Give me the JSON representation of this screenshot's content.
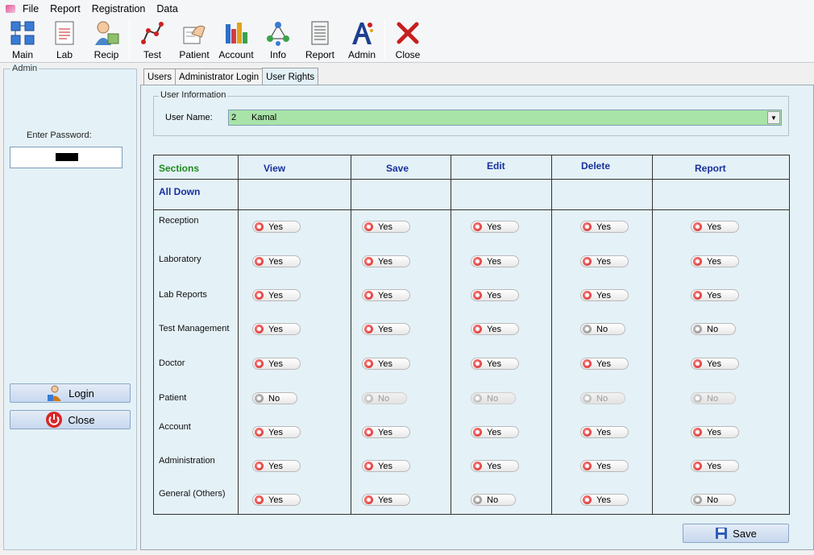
{
  "menu": [
    "File",
    "Report",
    "Registration",
    "Data"
  ],
  "toolbar": [
    {
      "label": "Main",
      "icon": "main-icon"
    },
    {
      "label": "Lab",
      "icon": "lab-icon"
    },
    {
      "label": "Recip",
      "icon": "reception-icon"
    },
    {
      "label": "Test",
      "icon": "test-icon"
    },
    {
      "label": "Patient",
      "icon": "patient-icon"
    },
    {
      "label": "Account",
      "icon": "account-icon"
    },
    {
      "label": "Info",
      "icon": "info-icon"
    },
    {
      "label": "Report",
      "icon": "report-icon"
    },
    {
      "label": "Admin",
      "icon": "admin-icon"
    },
    {
      "label": "Close",
      "icon": "close-icon"
    }
  ],
  "left_panel": {
    "title": "Admin",
    "password_label": "Enter Password:",
    "login_label": "Login",
    "close_label": "Close"
  },
  "tabs": [
    "Users",
    "Administrator Login",
    "User Rights"
  ],
  "active_tab": "User Rights",
  "user_info": {
    "legend": "User Information",
    "label": "User Name:",
    "user_id": "2",
    "user_name": "Kamal"
  },
  "grid": {
    "columns": [
      "Sections",
      "View",
      "Save",
      "Edit",
      "Delete",
      "Report"
    ],
    "all_down_label": "All Down",
    "rows": [
      {
        "section": "Reception",
        "values": [
          "Yes",
          "Yes",
          "Yes",
          "Yes",
          "Yes"
        ],
        "disabled": [
          false,
          false,
          false,
          false,
          false
        ]
      },
      {
        "section": "Laboratory",
        "values": [
          "Yes",
          "Yes",
          "Yes",
          "Yes",
          "Yes"
        ],
        "disabled": [
          false,
          false,
          false,
          false,
          false
        ]
      },
      {
        "section": "Lab Reports",
        "values": [
          "Yes",
          "Yes",
          "Yes",
          "Yes",
          "Yes"
        ],
        "disabled": [
          false,
          false,
          false,
          false,
          false
        ]
      },
      {
        "section": "Test Management",
        "values": [
          "Yes",
          "Yes",
          "Yes",
          "No",
          "No"
        ],
        "disabled": [
          false,
          false,
          false,
          false,
          false
        ]
      },
      {
        "section": "Doctor",
        "values": [
          "Yes",
          "Yes",
          "Yes",
          "Yes",
          "Yes"
        ],
        "disabled": [
          false,
          false,
          false,
          false,
          false
        ]
      },
      {
        "section": "Patient",
        "values": [
          "No",
          "No",
          "No",
          "No",
          "No"
        ],
        "disabled": [
          false,
          true,
          true,
          true,
          true
        ]
      },
      {
        "section": "Account",
        "values": [
          "Yes",
          "Yes",
          "Yes",
          "Yes",
          "Yes"
        ],
        "disabled": [
          false,
          false,
          false,
          false,
          false
        ]
      },
      {
        "section": "Administration",
        "values": [
          "Yes",
          "Yes",
          "Yes",
          "Yes",
          "Yes"
        ],
        "disabled": [
          false,
          false,
          false,
          false,
          false
        ]
      },
      {
        "section": "General (Others)",
        "values": [
          "Yes",
          "Yes",
          "No",
          "Yes",
          "No"
        ],
        "disabled": [
          false,
          false,
          false,
          false,
          false
        ]
      }
    ]
  },
  "save_label": "Save",
  "colors": {
    "panel_bg": "#e4f1f7",
    "selected_user_bg": "#a8e3a8",
    "header_text": "#17309e",
    "sections_header": "#1f8a1f",
    "toggle_on": "#d01f1f"
  }
}
